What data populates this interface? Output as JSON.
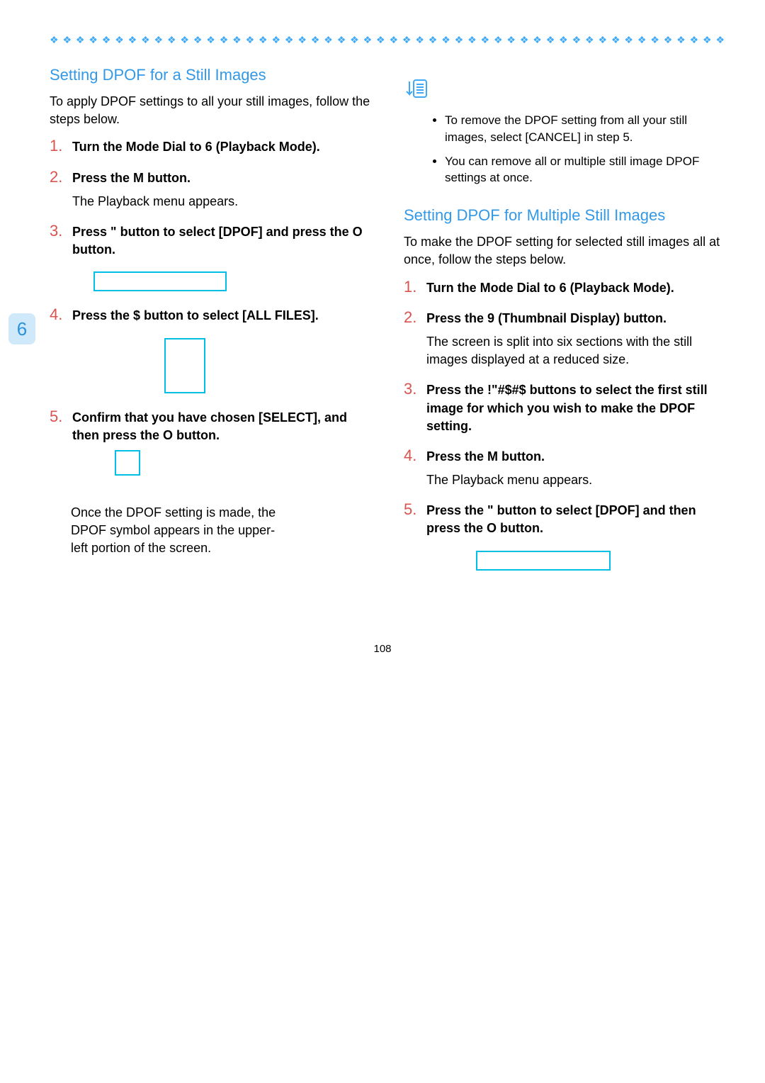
{
  "chapter_tab": "6",
  "page_number": "108",
  "left": {
    "title": "Setting DPOF for a Still Images",
    "intro": "To apply DPOF settings to all your still images, follow the steps below.",
    "steps": [
      {
        "title": "Turn the Mode Dial to 6 (Playback Mode)."
      },
      {
        "title": "Press the M button.",
        "body": "The Playback menu appears."
      },
      {
        "title": "Press \" button to select [DPOF] and press the O button."
      },
      {
        "title": "Press the $ button to select [ALL FILES]."
      },
      {
        "title": "Confirm that you have chosen [SELECT], and then press the O button."
      }
    ],
    "afternote": "Once the DPOF setting is made, the DPOF symbol appears in the upper-left portion of the screen."
  },
  "right": {
    "notes": [
      "To remove the DPOF setting from all your still images, select [CANCEL] in step 5.",
      "You can remove all or multiple still image DPOF settings at once."
    ],
    "title": "Setting DPOF for Multiple Still Images",
    "intro": "To make the DPOF setting for selected still images all at once, follow the steps below.",
    "steps": [
      {
        "title": "Turn the Mode Dial to 6 (Playback Mode)."
      },
      {
        "title": "Press the 9 (Thumbnail Display) button.",
        "body": "The screen is split into six sections with the still images displayed at a reduced size."
      },
      {
        "title": "Press the !\"#$#$ buttons to select the first still image for which you wish to make the DPOF setting."
      },
      {
        "title": "Press the M button.",
        "body": "The Playback menu appears."
      },
      {
        "title": "Press the \" button to select [DPOF] and then press the O button."
      }
    ]
  }
}
